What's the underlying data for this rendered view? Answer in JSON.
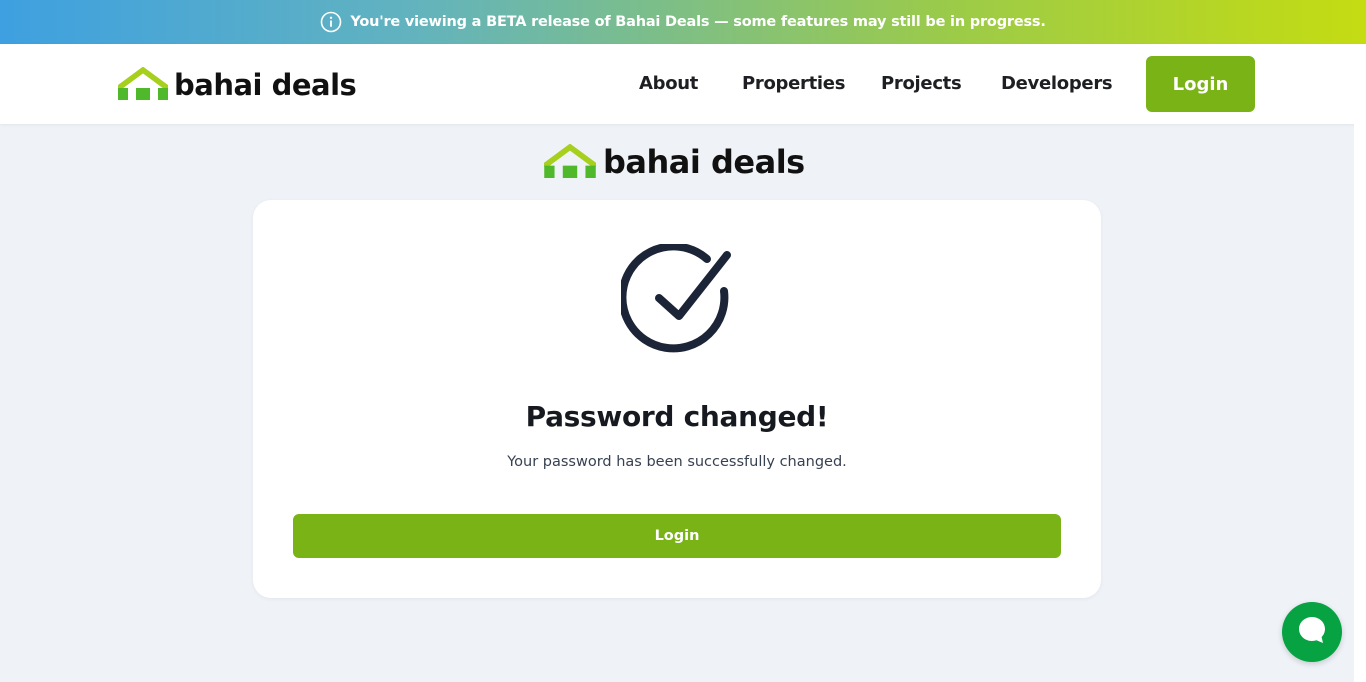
{
  "banner": {
    "icon": "info-icon",
    "text": "You're viewing a BETA release of Bahai Deals — some features may still be in progress."
  },
  "navbar": {
    "brand": {
      "name": "bahai deals",
      "icon": "house-logo-icon"
    },
    "links": [
      {
        "label": "About"
      },
      {
        "label": "Properties"
      },
      {
        "label": "Projects"
      },
      {
        "label": "Developers"
      }
    ],
    "login_label": "Login"
  },
  "page": {
    "brand": {
      "name": "bahai deals",
      "icon": "house-logo-icon"
    },
    "status_icon": "check-circle-icon",
    "title": "Password changed!",
    "message": "Your password has been successfully changed.",
    "login_label": "Login"
  },
  "chat": {
    "icon": "chat-bubble-icon"
  },
  "colors": {
    "accent_green": "#7ab316",
    "chat_green": "#07a343",
    "page_bg": "#eff3f8",
    "text_dark": "#16191f"
  }
}
